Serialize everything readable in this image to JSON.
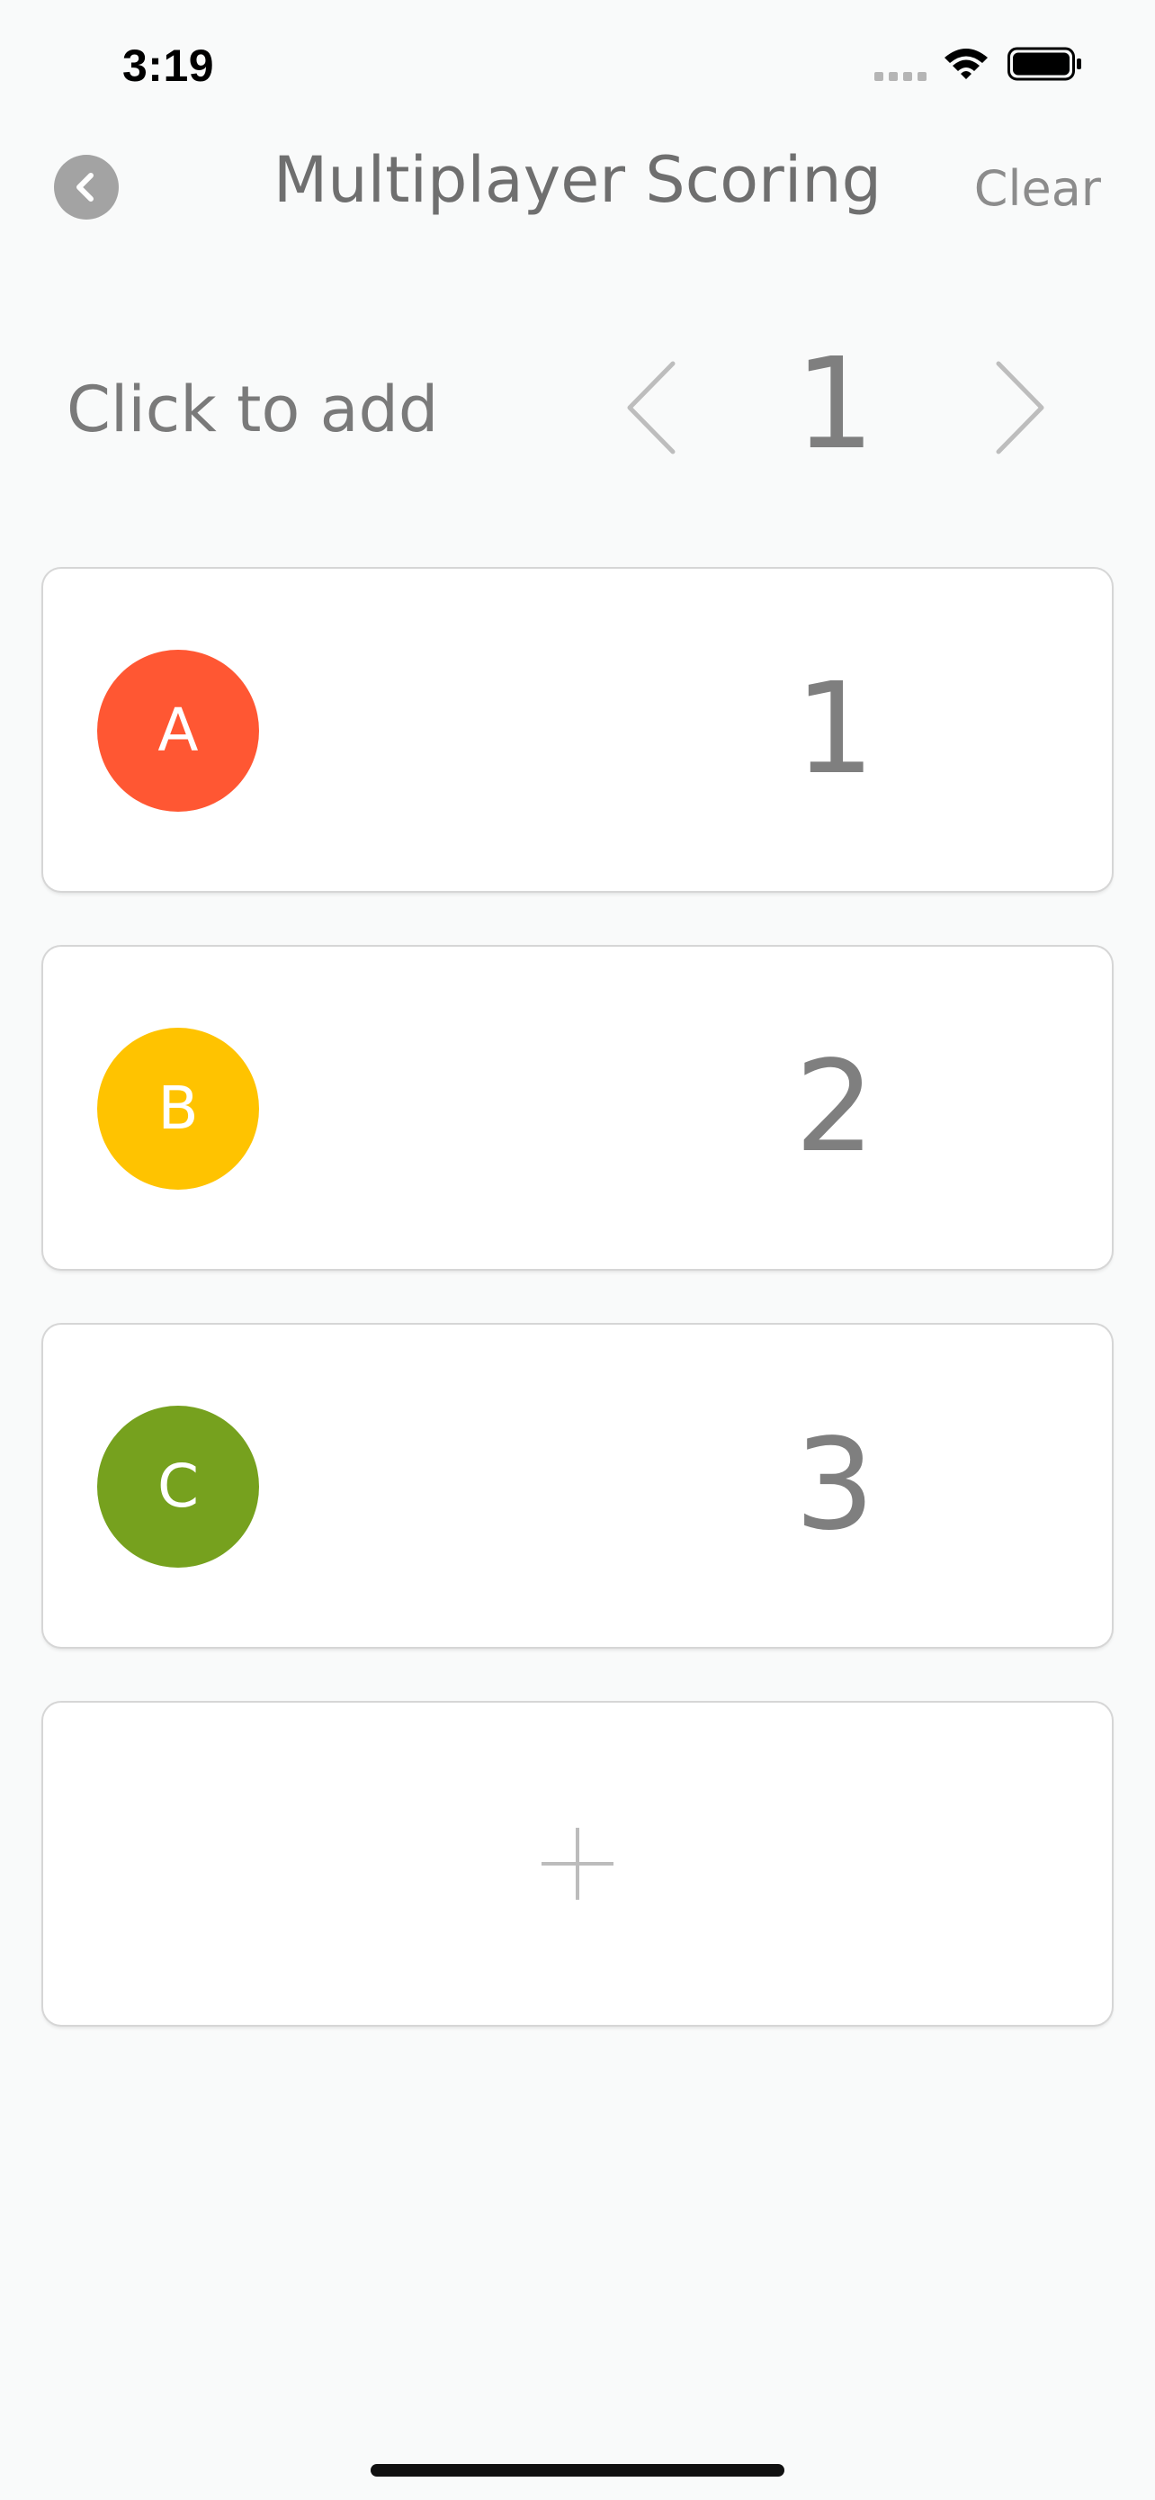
{
  "status_bar": {
    "time": "3:19",
    "icons": [
      "cellular-signal-icon",
      "wifi-icon",
      "battery-icon"
    ]
  },
  "nav": {
    "back_icon": "chevron-left-icon",
    "title": "Multiplayer Scoring",
    "clear_label": "Clear"
  },
  "increment": {
    "label": "Click to add",
    "value": "1",
    "prev_icon": "chevron-left-icon",
    "next_icon": "chevron-right-icon"
  },
  "players": [
    {
      "name": "A",
      "score": "1",
      "color": "#ff5733"
    },
    {
      "name": "B",
      "score": "2",
      "color": "#ffc300"
    },
    {
      "name": "C",
      "score": "3",
      "color": "#76a11e"
    }
  ],
  "add_player": {
    "icon": "plus-icon"
  },
  "colors": {
    "background": "#f9fafa",
    "card": "#ffffff",
    "text_muted": "#7f7f7f"
  }
}
